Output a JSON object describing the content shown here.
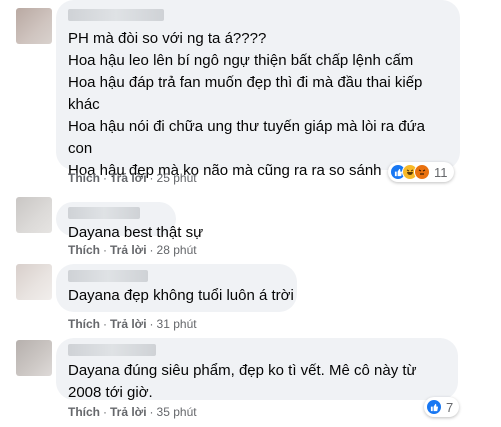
{
  "comments": [
    {
      "lines": [
        "PH mà đòi so với ng ta á????",
        "Hoa hậu leo lên bí ngô ngự thiện bất chấp lệnh cấm",
        "Hoa hậu đáp trả fan muốn đẹp thì đi mà đầu thai kiếp",
        "khác",
        "Hoa hậu nói đi chữa ung thư tuyến giáp mà lòi ra đứa",
        "con",
        "Hoa hậu đẹp mà ko não mà cũng ra ra so sánh"
      ],
      "like_label": "Thích",
      "reply_label": "Trả lời",
      "time": "25 phút",
      "reaction_count": "11",
      "reaction_icons": [
        "like-icon",
        "haha-icon",
        "angry-icon"
      ]
    },
    {
      "lines": [
        "Dayana best thật sự"
      ],
      "like_label": "Thích",
      "reply_label": "Trả lời",
      "time": "28 phút"
    },
    {
      "lines": [
        "Dayana đẹp không tuổi luôn á trời"
      ],
      "like_label": "Thích",
      "reply_label": "Trả lời",
      "time": "31 phút"
    },
    {
      "lines": [
        "Dayana đúng siêu phẩm, đẹp ko tì vết. Mê cô này từ",
        "2008 tới giờ."
      ],
      "like_label": "Thích",
      "reply_label": "Trả lời",
      "time": "35 phút",
      "reaction_count": "7",
      "reaction_icons": [
        "like-icon"
      ]
    }
  ],
  "colors": {
    "bubble": "#f0f2f5",
    "meta_text": "#65676b",
    "like": "#1877f2",
    "haha": "#f7b928",
    "angry": "#e9710f"
  }
}
